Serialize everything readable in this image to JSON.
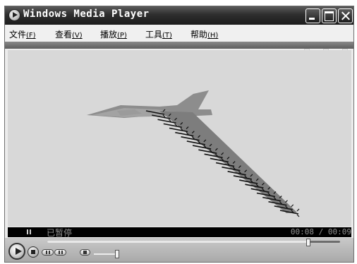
{
  "window": {
    "title": "Windows Media Player",
    "controls": {
      "minimize": "minimize",
      "maximize": "maximize",
      "close": "close"
    }
  },
  "menu": [
    {
      "label": "文件",
      "key": "(F)"
    },
    {
      "label": "查看",
      "key": "(V)"
    },
    {
      "label": "播放",
      "key": "(P)"
    },
    {
      "label": "工具",
      "key": "(T)"
    },
    {
      "label": "帮助",
      "key": "(H)"
    }
  ],
  "status": {
    "state_text": "已暂停",
    "time_text": "00:08 / 00:09"
  },
  "playback": {
    "position_fraction": 0.888,
    "volume_fraction": 0.9
  },
  "icons": {
    "app": "media-player-logo-icon",
    "play": "play-icon",
    "stop": "stop-icon",
    "prev": "previous-track-icon",
    "next": "next-track-icon",
    "mute": "mute-icon",
    "status": "pause-icon"
  },
  "colors": {
    "titlebar": "#1c1c1c",
    "video_background": "#d8d8d8",
    "status_background": "#000000",
    "status_text": "#8f8f8f",
    "jet": "#8f8f8f",
    "missiles": "#111111"
  }
}
